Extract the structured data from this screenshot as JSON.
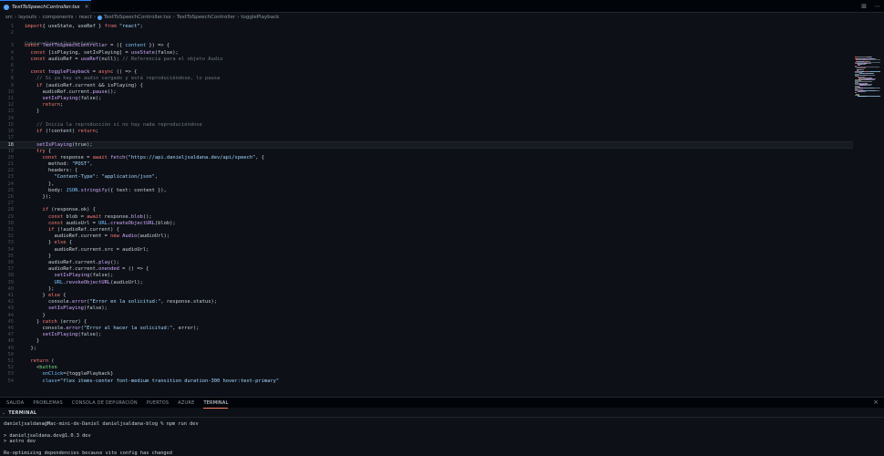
{
  "tab": {
    "label": "TextToSpeechController.tsx",
    "close": "×"
  },
  "top_actions": [
    "⊞",
    "⋯"
  ],
  "breadcrumb": [
    "src",
    "layouts",
    "components",
    "react",
    "TextToSpeechController.tsx",
    "TextToSpeechController",
    "togglePlayback"
  ],
  "codelens": "Codeium: Options | Test this function",
  "current_line": 18,
  "code": [
    [
      [
        "kw",
        "import"
      ],
      [
        "",
        "{ useState, useRef } "
      ],
      [
        "kw",
        "from"
      ],
      [
        "str",
        " \"react\""
      ],
      [
        "",
        ";"
      ]
    ],
    [],
    [
      [
        "kw",
        "const"
      ],
      [
        "fn",
        " TextToSpeechController"
      ],
      [
        "",
        " = ({ "
      ],
      [
        "vr",
        "content"
      ],
      [
        "",
        " }) => {"
      ]
    ],
    [
      [
        "",
        "  "
      ],
      [
        "kw",
        "const"
      ],
      [
        "",
        " [isPlaying, setIsPlaying] = "
      ],
      [
        "fn",
        "useState"
      ],
      [
        "",
        "(false);"
      ]
    ],
    [
      [
        "",
        "  "
      ],
      [
        "kw",
        "const"
      ],
      [
        "",
        " audioRef = "
      ],
      [
        "fn",
        "useRef"
      ],
      [
        "",
        "(null); "
      ],
      [
        "cm",
        "// Referencia para el objeto Audio"
      ]
    ],
    [],
    [
      [
        "",
        "  "
      ],
      [
        "kw",
        "const"
      ],
      [
        "fn",
        " togglePlayback"
      ],
      [
        "",
        " = "
      ],
      [
        "kw",
        "async"
      ],
      [
        "",
        " () => {"
      ]
    ],
    [
      [
        "cm",
        "    // Si ya hay un audio cargado y está reproduciéndose, lo pausa"
      ]
    ],
    [
      [
        "",
        "    "
      ],
      [
        "kw",
        "if"
      ],
      [
        "",
        " (audioRef.current && isPlaying) {"
      ]
    ],
    [
      [
        "",
        "      audioRef.current."
      ],
      [
        "fn",
        "pause"
      ],
      [
        "",
        "();"
      ]
    ],
    [
      [
        "",
        "      "
      ],
      [
        "fn",
        "setIsPlaying"
      ],
      [
        "",
        "(false);"
      ]
    ],
    [
      [
        "",
        "      "
      ],
      [
        "kw",
        "return"
      ],
      [
        "",
        ";"
      ]
    ],
    [
      [
        "",
        "    }"
      ]
    ],
    [],
    [
      [
        "cm",
        "    // Inicia la reproducción si no hay nada reproduciéndose"
      ]
    ],
    [
      [
        "",
        "    "
      ],
      [
        "kw",
        "if"
      ],
      [
        "",
        " (!content) "
      ],
      [
        "kw",
        "return"
      ],
      [
        "",
        ";"
      ]
    ],
    [],
    [
      [
        "",
        "    "
      ],
      [
        "fn",
        "setIsPlaying"
      ],
      [
        "",
        "(true);"
      ]
    ],
    [
      [
        "",
        "    "
      ],
      [
        "kw",
        "try"
      ],
      [
        "",
        " {"
      ]
    ],
    [
      [
        "",
        "      "
      ],
      [
        "kw",
        "const"
      ],
      [
        "",
        " response = "
      ],
      [
        "kw",
        "await"
      ],
      [
        "fn",
        " fetch"
      ],
      [
        "",
        "("
      ],
      [
        "str",
        "\"https://api.danieljsaldana.dev/api/speech\""
      ],
      [
        "",
        ", {"
      ]
    ],
    [
      [
        "",
        "        method: "
      ],
      [
        "str",
        "\"POST\""
      ],
      [
        "",
        ","
      ]
    ],
    [
      [
        "",
        "        headers: {"
      ]
    ],
    [
      [
        "",
        "          "
      ],
      [
        "str",
        "\"Content-Type\""
      ],
      [
        "",
        ": "
      ],
      [
        "str",
        "\"application/json\""
      ],
      [
        "",
        ","
      ]
    ],
    [
      [
        "",
        "        },"
      ]
    ],
    [
      [
        "",
        "        body: "
      ],
      [
        "vr",
        "JSON"
      ],
      [
        "",
        "."
      ],
      [
        "fn",
        "stringify"
      ],
      [
        "",
        "({ text: content }),"
      ]
    ],
    [
      [
        "",
        "      });"
      ]
    ],
    [],
    [
      [
        "",
        "      "
      ],
      [
        "kw",
        "if"
      ],
      [
        "",
        " (response.ok) {"
      ]
    ],
    [
      [
        "",
        "        "
      ],
      [
        "kw",
        "const"
      ],
      [
        "",
        " blob = "
      ],
      [
        "kw",
        "await"
      ],
      [
        "",
        " response."
      ],
      [
        "fn",
        "blob"
      ],
      [
        "",
        "();"
      ]
    ],
    [
      [
        "",
        "        "
      ],
      [
        "kw",
        "const"
      ],
      [
        "",
        " audioUrl = "
      ],
      [
        "vr",
        "URL"
      ],
      [
        "",
        "."
      ],
      [
        "fn",
        "createObjectURL"
      ],
      [
        "",
        "(blob);"
      ]
    ],
    [
      [
        "",
        "        "
      ],
      [
        "kw",
        "if"
      ],
      [
        "",
        " (!audioRef.current) {"
      ]
    ],
    [
      [
        "",
        "          audioRef.current = "
      ],
      [
        "kw",
        "new"
      ],
      [
        "fn",
        " Audio"
      ],
      [
        "",
        "(audioUrl);"
      ]
    ],
    [
      [
        "",
        "        } "
      ],
      [
        "kw",
        "else"
      ],
      [
        "",
        " {"
      ]
    ],
    [
      [
        "",
        "          audioRef.current.src = audioUrl;"
      ]
    ],
    [
      [
        "",
        "        }"
      ]
    ],
    [
      [
        "",
        "        audioRef.current."
      ],
      [
        "fn",
        "play"
      ],
      [
        "",
        "();"
      ]
    ],
    [
      [
        "",
        "        audioRef.current."
      ],
      [
        "fn",
        "onended"
      ],
      [
        "",
        " = () => {"
      ]
    ],
    [
      [
        "",
        "          "
      ],
      [
        "fn",
        "setIsPlaying"
      ],
      [
        "",
        "(false);"
      ]
    ],
    [
      [
        "",
        "          "
      ],
      [
        "vr",
        "URL"
      ],
      [
        "",
        "."
      ],
      [
        "fn",
        "revokeObjectURL"
      ],
      [
        "",
        "(audioUrl);"
      ]
    ],
    [
      [
        "",
        "        };"
      ]
    ],
    [
      [
        "",
        "      } "
      ],
      [
        "kw",
        "else"
      ],
      [
        "",
        " {"
      ]
    ],
    [
      [
        "",
        "        console."
      ],
      [
        "fn",
        "error"
      ],
      [
        "",
        "("
      ],
      [
        "str",
        "\"Error en la solicitud:\""
      ],
      [
        "",
        ", response.status);"
      ]
    ],
    [
      [
        "",
        "        "
      ],
      [
        "fn",
        "setIsPlaying"
      ],
      [
        "",
        "(false);"
      ]
    ],
    [
      [
        "",
        "      }"
      ]
    ],
    [
      [
        "",
        "    } "
      ],
      [
        "kw",
        "catch"
      ],
      [
        "",
        " (error) {"
      ]
    ],
    [
      [
        "",
        "      console."
      ],
      [
        "fn",
        "error"
      ],
      [
        "",
        "("
      ],
      [
        "str",
        "\"Error al hacer la solicitud:\""
      ],
      [
        "",
        ", error);"
      ]
    ],
    [
      [
        "",
        "      "
      ],
      [
        "fn",
        "setIsPlaying"
      ],
      [
        "",
        "(false);"
      ]
    ],
    [
      [
        "",
        "    }"
      ]
    ],
    [
      [
        "",
        "  };"
      ]
    ],
    [],
    [
      [
        "",
        "  "
      ],
      [
        "kw",
        "return"
      ],
      [
        "",
        " ("
      ]
    ],
    [
      [
        "",
        "    <"
      ],
      [
        "tg",
        "button"
      ]
    ],
    [
      [
        "",
        "      "
      ],
      [
        "vr",
        "onClick"
      ],
      [
        "",
        "={togglePlayback}"
      ]
    ],
    [
      [
        "",
        "      "
      ],
      [
        "vr",
        "class"
      ],
      [
        "",
        "="
      ],
      [
        "str",
        "\"flex items-center font-medium transition duration-300 hover:text-primary\""
      ]
    ]
  ],
  "panel_tabs": [
    {
      "label": "SALIDA",
      "active": false
    },
    {
      "label": "PROBLEMAS",
      "active": false
    },
    {
      "label": "CONSOLA DE DEPURACIÓN",
      "active": false
    },
    {
      "label": "PUERTOS",
      "active": false
    },
    {
      "label": "AZURE",
      "active": false
    },
    {
      "label": "TERMINAL",
      "active": true
    }
  ],
  "panel_close": "×",
  "terminal_title": "TERMINAL",
  "terminal_lines": [
    "danieljsaldana@Mac-mini-de-Daniel danieljsaldana-blog % npm run dev",
    "",
    "> danieljsaldana.dev@1.0.3 dev",
    "> astro dev",
    "",
    "Re-optimizing dependencies because vite config has changed"
  ],
  "colors": {
    "accent": "#2f81f7",
    "keyword": "#ff7b72",
    "function": "#d2a8ff",
    "string": "#a5d6ff",
    "comment": "#6e7681"
  }
}
